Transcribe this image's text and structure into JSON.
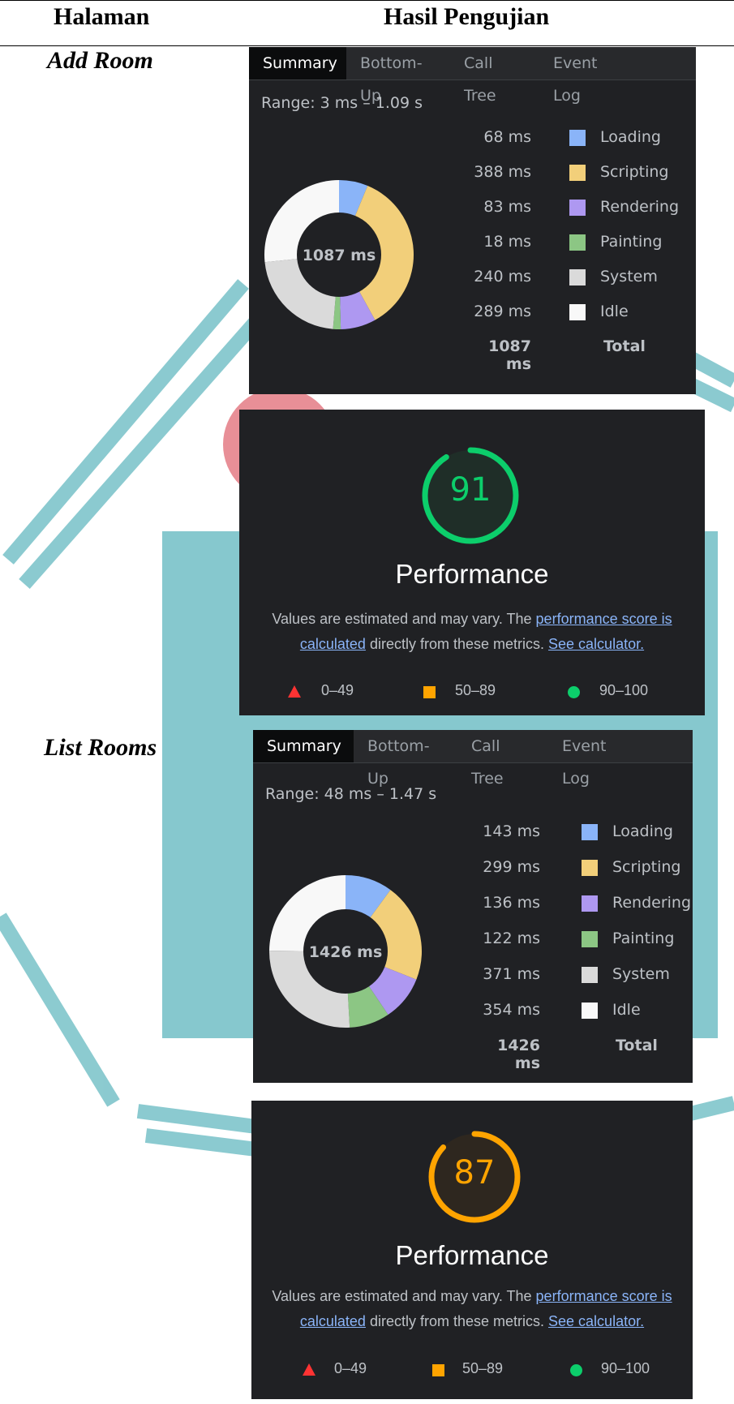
{
  "table": {
    "col_page": "Halaman",
    "col_result": "Hasil Pengujian"
  },
  "colors": {
    "loading": "#8ab4f8",
    "scripting": "#f2cf7a",
    "rendering": "#ae98f1",
    "painting": "#8cc684",
    "system": "#dadada",
    "idle": "#f8f8f8",
    "lh_good": "#0cce6b",
    "lh_average": "#ffa400",
    "lh_fail": "#ff3333",
    "watermark": "#7fc5cb"
  },
  "rows": [
    {
      "label": "Add Room",
      "summary": {
        "tabs": [
          "Summary",
          "Bottom-Up",
          "Call Tree",
          "Event Log"
        ],
        "range": "Range: 3 ms – 1.09 s",
        "center": "1087 ms",
        "items": [
          {
            "value": "68 ms",
            "name": "Loading"
          },
          {
            "value": "388 ms",
            "name": "Scripting"
          },
          {
            "value": "83 ms",
            "name": "Rendering"
          },
          {
            "value": "18 ms",
            "name": "Painting"
          },
          {
            "value": "240 ms",
            "name": "System"
          },
          {
            "value": "289 ms",
            "name": "Idle"
          }
        ],
        "total_value": "1087 ms",
        "total_label": "Total"
      },
      "lighthouse": {
        "score": "91",
        "score_value": 91,
        "title": "Performance",
        "desc_pre": "Values are estimated and may vary. The ",
        "link1": "performance score is calculated",
        "desc_mid": " directly from these metrics. ",
        "link2": "See calculator.",
        "legend_fail": "0–49",
        "legend_avg": "50–89",
        "legend_pass": "90–100"
      }
    },
    {
      "label": "List Rooms",
      "summary": {
        "tabs": [
          "Summary",
          "Bottom-Up",
          "Call Tree",
          "Event Log"
        ],
        "range": "Range: 48 ms – 1.47 s",
        "center": "1426 ms",
        "items": [
          {
            "value": "143 ms",
            "name": "Loading"
          },
          {
            "value": "299 ms",
            "name": "Scripting"
          },
          {
            "value": "136 ms",
            "name": "Rendering"
          },
          {
            "value": "122 ms",
            "name": "Painting"
          },
          {
            "value": "371 ms",
            "name": "System"
          },
          {
            "value": "354 ms",
            "name": "Idle"
          }
        ],
        "total_value": "1426 ms",
        "total_label": "Total"
      },
      "lighthouse": {
        "score": "87",
        "score_value": 87,
        "title": "Performance",
        "desc_pre": "Values are estimated and may vary. The ",
        "link1": "performance score is calculated",
        "desc_mid": " directly from these metrics. ",
        "link2": "See calculator.",
        "legend_fail": "0–49",
        "legend_avg": "50–89",
        "legend_pass": "90–100"
      }
    }
  ]
}
